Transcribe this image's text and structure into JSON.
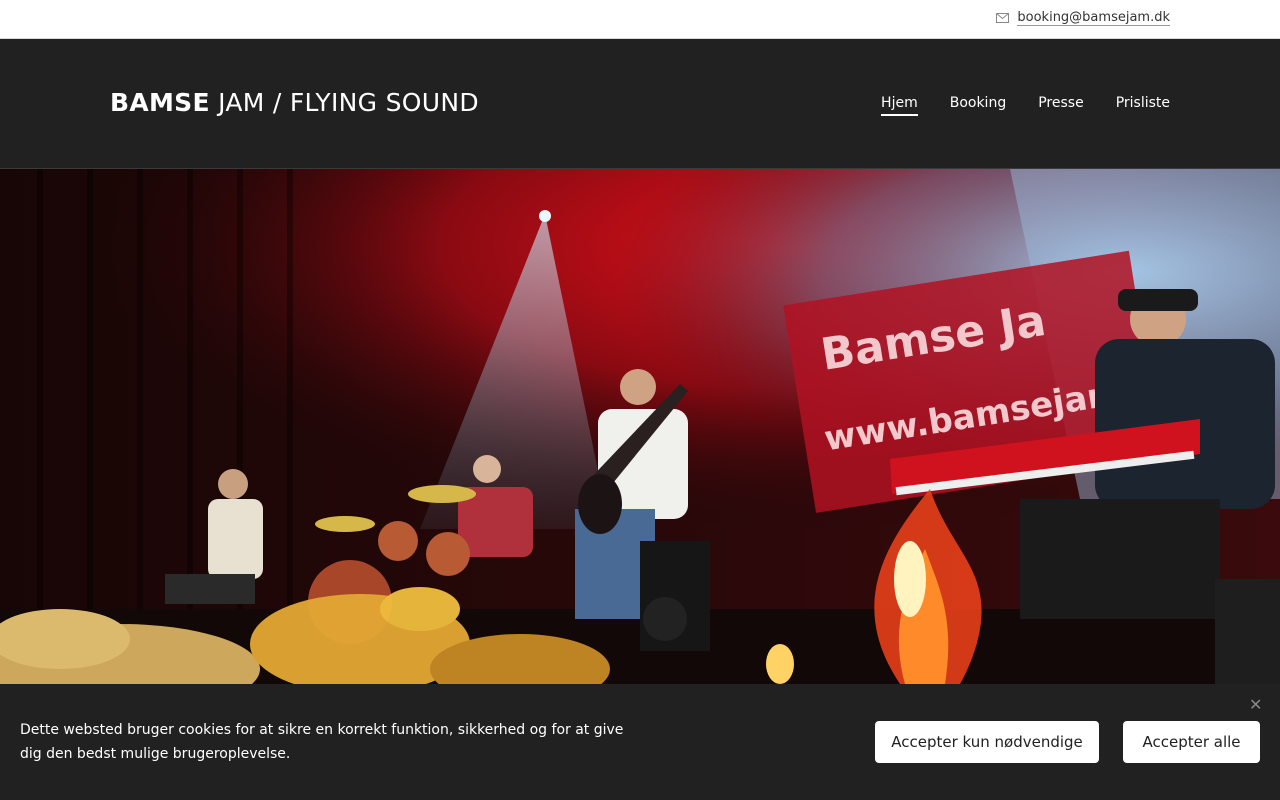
{
  "topbar": {
    "email": "booking@bamsejam.dk",
    "icon": "mail-icon"
  },
  "header": {
    "logo_strong": "BAMSE",
    "logo_rest": " JAM / FLYING SOUND",
    "nav": [
      {
        "label": "Hjem",
        "active": true
      },
      {
        "label": "Booking"
      },
      {
        "label": "Presse"
      },
      {
        "label": "Prisliste"
      }
    ]
  },
  "hero": {
    "banner_line1": "Bamse Ja",
    "banner_line2": "www.bamsejam"
  },
  "cookie": {
    "text": "Dette websted bruger cookies for at sikre en korrekt funktion, sikkerhed og for at give dig den bedst mulige brugeroplevelse.",
    "accept_necessary": "Accepter kun nødvendige",
    "accept_all": "Accepter alle",
    "close_icon": "close-icon"
  },
  "colors": {
    "header_bg": "#212121",
    "topbar_bg": "#ffffff",
    "button_bg": "#ffffff"
  }
}
